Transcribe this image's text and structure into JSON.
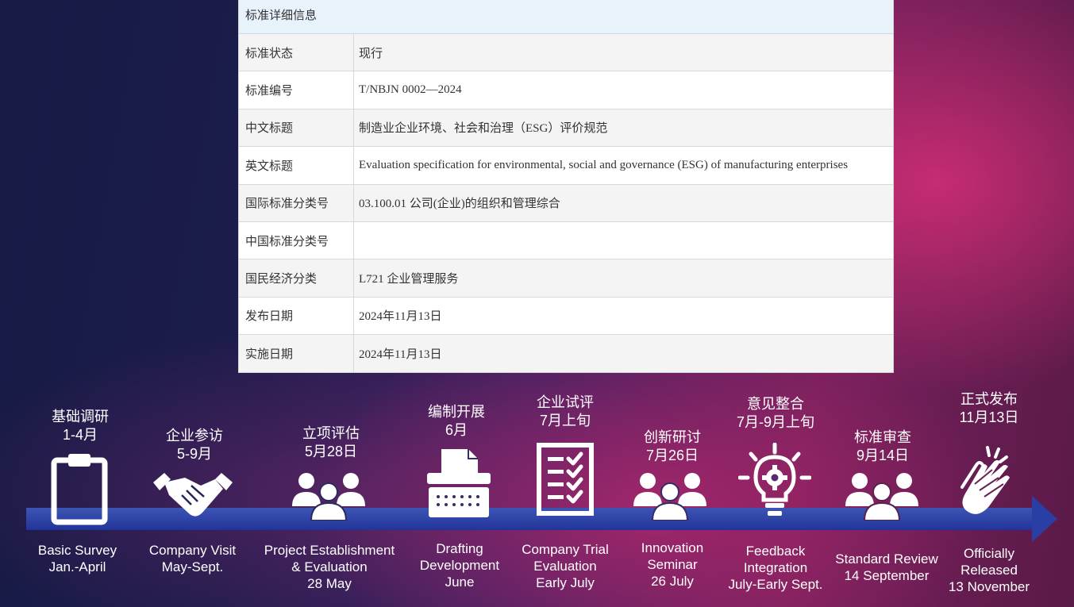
{
  "table": {
    "header": "标准详细信息",
    "rows": [
      {
        "label": "标准状态",
        "value": "现行"
      },
      {
        "label": "标准编号",
        "value": "T/NBJN 0002—2024"
      },
      {
        "label": "中文标题",
        "value": "制造业企业环境、社会和治理（ESG）评价规范"
      },
      {
        "label": "英文标题",
        "value": "Evaluation specification for environmental, social and governance (ESG) of manufacturing enterprises"
      },
      {
        "label": "国际标准分类号",
        "value": "03.100.01 公司(企业)的组织和管理综合"
      },
      {
        "label": "中国标准分类号",
        "value": ""
      },
      {
        "label": "国民经济分类",
        "value": "L721 企业管理服务"
      },
      {
        "label": "发布日期",
        "value": "2024年11月13日"
      },
      {
        "label": "实施日期",
        "value": "2024年11月13日"
      }
    ]
  },
  "timeline": {
    "stages": [
      {
        "cn_title": "基础调研",
        "cn_date": "1-4月",
        "en_title": "Basic Survey",
        "en_line2": "",
        "en_date": "Jan.-April",
        "icon": "clipboard-icon"
      },
      {
        "cn_title": "企业参访",
        "cn_date": "5-9月",
        "en_title": "Company Visit",
        "en_line2": "",
        "en_date": "May-Sept.",
        "icon": "handshake-icon"
      },
      {
        "cn_title": "立项评估",
        "cn_date": "5月28日",
        "en_title": "Project Establishment",
        "en_line2": "& Evaluation",
        "en_date": "28 May",
        "icon": "group-icon"
      },
      {
        "cn_title": "编制开展",
        "cn_date": "6月",
        "en_title": "Drafting",
        "en_line2": "Development",
        "en_date": "June",
        "icon": "typewriter-icon"
      },
      {
        "cn_title": "企业试评",
        "cn_date": "7月上旬",
        "en_title": "Company Trial",
        "en_line2": "Evaluation",
        "en_date": "Early July",
        "icon": "checklist-icon"
      },
      {
        "cn_title": "创新研讨",
        "cn_date": "7月26日",
        "en_title": "Innovation",
        "en_line2": "Seminar",
        "en_date": "26 July",
        "icon": "group-icon"
      },
      {
        "cn_title": "意见整合",
        "cn_date": "7月-9月上旬",
        "en_title": "Feedback",
        "en_line2": "Integration",
        "en_date": "July-Early Sept.",
        "icon": "lightbulb-gear-icon"
      },
      {
        "cn_title": "标准审查",
        "cn_date": "9月14日",
        "en_title": "Standard Review",
        "en_line2": "",
        "en_date": "14 September",
        "icon": "group-icon"
      },
      {
        "cn_title": "正式发布",
        "cn_date": "11月13日",
        "en_title": "Officially",
        "en_line2": "Released",
        "en_date": "13 November",
        "icon": "clapping-hands-icon"
      }
    ]
  }
}
